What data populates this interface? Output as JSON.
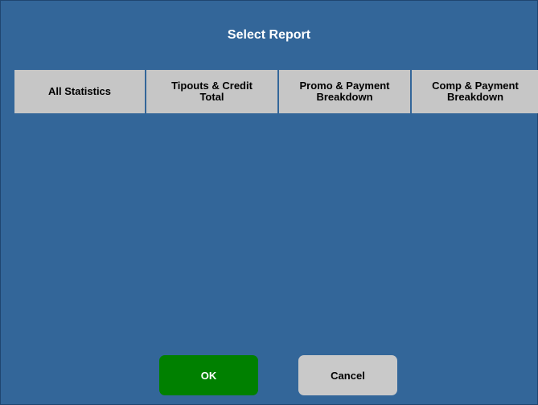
{
  "dialog": {
    "title": "Select Report"
  },
  "reports": [
    {
      "label": "All Statistics"
    },
    {
      "label": "Tipouts & Credit\nTotal"
    },
    {
      "label": "Promo & Payment\nBreakdown"
    },
    {
      "label": "Comp & Payment\nBreakdown"
    }
  ],
  "actions": {
    "ok_label": "OK",
    "cancel_label": "Cancel"
  },
  "colors": {
    "dialog_background": "#336699",
    "report_button": "#c6c6c6",
    "ok_button": "#008000",
    "cancel_button": "#c9c9c9"
  }
}
